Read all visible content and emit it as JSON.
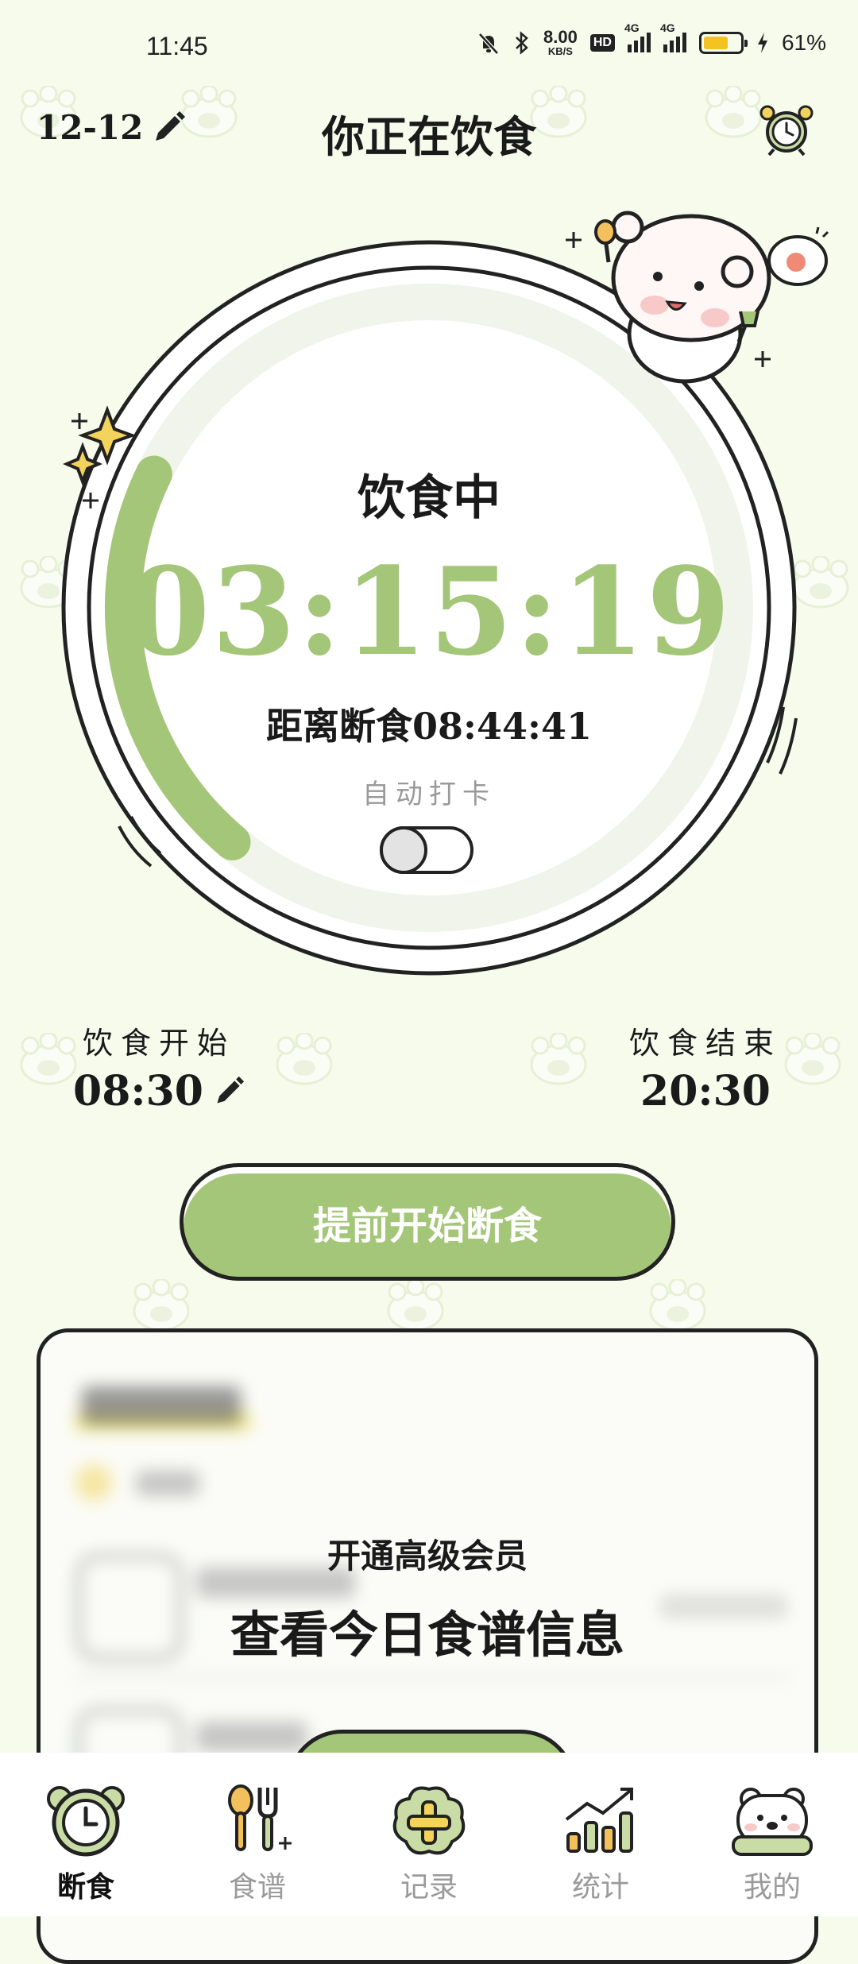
{
  "status_bar": {
    "time": "11:45",
    "net_speed": "8.00",
    "net_unit": "KB/S",
    "hd": "HD",
    "sig1": "4G",
    "sig2": "4G",
    "battery": "61%",
    "battery_level": 0.61
  },
  "header": {
    "date": "12-12",
    "title": "你正在饮食"
  },
  "dial": {
    "status": "饮食中",
    "timer": "03:15:19",
    "remaining": "距离断食08:44:41",
    "auto_checkin_label": "自动打卡",
    "auto_checkin_on": false
  },
  "schedule": {
    "start_label": "饮食开始",
    "start_time": "08:30",
    "end_label": "饮食结束",
    "end_time": "20:30"
  },
  "cta": {
    "label": "提前开始断食"
  },
  "recipe_card": {
    "line1": "开通高级会员",
    "line2": "查看今日食谱信息"
  },
  "tabbar": {
    "items": [
      {
        "label": "断食",
        "icon": "clock-icon",
        "active": true
      },
      {
        "label": "食谱",
        "icon": "spoon-fork-icon",
        "active": false
      },
      {
        "label": "记录",
        "icon": "plus-icon",
        "active": false
      },
      {
        "label": "统计",
        "icon": "chart-icon",
        "active": false
      },
      {
        "label": "我的",
        "icon": "bear-icon",
        "active": false
      }
    ]
  },
  "colors": {
    "accent": "#a4c678",
    "background": "#f6fbec",
    "outline": "#222222"
  }
}
